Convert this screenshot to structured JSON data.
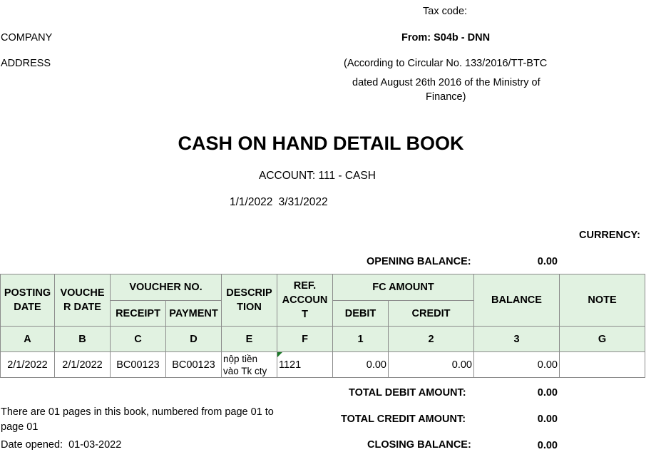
{
  "header": {
    "tax_code_label": "Tax code:",
    "company_label": "COMPANY",
    "address_label": "ADDRESS",
    "form": "From: S04b - DNN",
    "circular_line1": "(According to Circular No. 133/2016/TT-BTC",
    "circular_line2": "dated August 26th 2016 of the Ministry of",
    "circular_line3": "Finance)"
  },
  "title": "CASH ON HAND DETAIL BOOK",
  "account": "ACCOUNT: 111 - CASH",
  "period_from": "1/1/2022",
  "period_to": "3/31/2022",
  "currency_label": "CURRENCY:",
  "opening_balance_label": "OPENING BALANCE:",
  "opening_balance_value": "0.00",
  "table": {
    "headers": {
      "posting_date": "POSTING DATE",
      "voucher_date": "VOUCHE R DATE",
      "voucher_no": "VOUCHER NO.",
      "receipt": "RECEIPT",
      "payment": "PAYMENT",
      "description": "DESCRIP TION",
      "ref_account": "REF. ACCOUN T",
      "fc_amount": "FC AMOUNT",
      "debit": "DEBIT",
      "credit": "CREDIT",
      "balance": "BALANCE",
      "note": "NOTE"
    },
    "letters": [
      "A",
      "B",
      "C",
      "D",
      "E",
      "F",
      "1",
      "2",
      "3",
      "G"
    ],
    "rows": [
      {
        "posting_date": "2/1/2022",
        "voucher_date": "2/1/2022",
        "receipt": "BC00123",
        "payment": "BC00123",
        "description": "nộp tiền vào Tk cty",
        "ref_account": "1121",
        "debit": "0.00",
        "credit": "0.00",
        "balance": "0.00",
        "note": ""
      }
    ]
  },
  "totals": {
    "total_debit_label": "TOTAL DEBIT AMOUNT:",
    "total_debit_value": "0.00",
    "total_credit_label": "TOTAL CREDIT AMOUNT:",
    "total_credit_value": "0.00",
    "closing_balance_label": "CLOSING BALANCE:",
    "closing_balance_value": "0.00"
  },
  "footer": {
    "pages_note_line1": "There are 01 pages in this book, numbered from page 01 to",
    "pages_note_line2": "page 01",
    "date_opened_label": "Date opened:",
    "date_opened_value": "01-03-2022"
  },
  "colors": {
    "header_fill": "#e1f2e1",
    "grid_line": "#8c8c8c",
    "comment_marker": "#1d7a2a"
  }
}
